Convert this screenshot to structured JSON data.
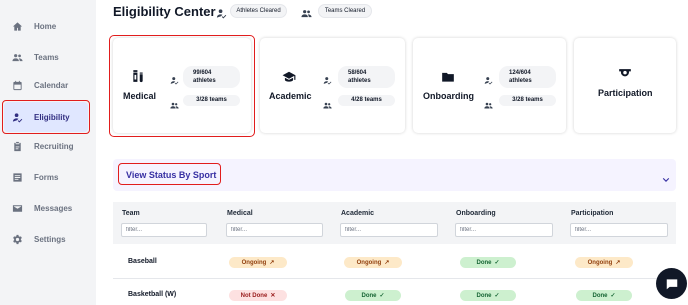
{
  "sidebar": {
    "items": [
      {
        "label": "Home",
        "icon": "home-icon"
      },
      {
        "label": "Teams",
        "icon": "users-icon"
      },
      {
        "label": "Calendar",
        "icon": "calendar-icon"
      },
      {
        "label": "Eligibility",
        "icon": "user-check-icon",
        "active": true
      },
      {
        "label": "Recruiting",
        "icon": "clipboard-icon"
      },
      {
        "label": "Forms",
        "icon": "list-icon"
      },
      {
        "label": "Messages",
        "icon": "envelope-icon"
      },
      {
        "label": "Settings",
        "icon": "gear-icon"
      }
    ]
  },
  "header": {
    "title": "Eligibility Center",
    "athletes_cleared": "Athletes Cleared",
    "teams_cleared": "Teams Cleared"
  },
  "cards": [
    {
      "label": "Medical",
      "icon": "pill-bottle-icon",
      "athletes_count": "99/604",
      "athletes_unit": "athletes",
      "teams": "3/28 teams"
    },
    {
      "label": "Academic",
      "icon": "graduation-cap-icon",
      "athletes_count": "58/604",
      "athletes_unit": "athletes",
      "teams": "4/28 teams"
    },
    {
      "label": "Onboarding",
      "icon": "folder-icon",
      "athletes_count": "124/604",
      "athletes_unit": "athletes",
      "teams": "3/28 teams"
    },
    {
      "label": "Participation",
      "icon": "whistle-icon"
    }
  ],
  "view_status": {
    "label": "View Status By Sport"
  },
  "table": {
    "columns": [
      "Team",
      "Medical",
      "Academic",
      "Onboarding",
      "Participation"
    ],
    "filter_placeholder": "filter...",
    "rows": [
      {
        "team": "Baseball",
        "medical": "Ongoing",
        "academic": "Ongoing",
        "onboarding": "Done",
        "participation": "Ongoing"
      },
      {
        "team": "Basketball (W)",
        "medical": "Not Done",
        "academic": "Done",
        "onboarding": "Done",
        "participation": "Done"
      }
    ]
  },
  "colors": {
    "accent": "#3730a3",
    "highlight": "#e11d1d",
    "ongoing_bg": "#fde9c8",
    "done_bg": "#cdf0cf",
    "notdone_bg": "#fde1e1"
  }
}
